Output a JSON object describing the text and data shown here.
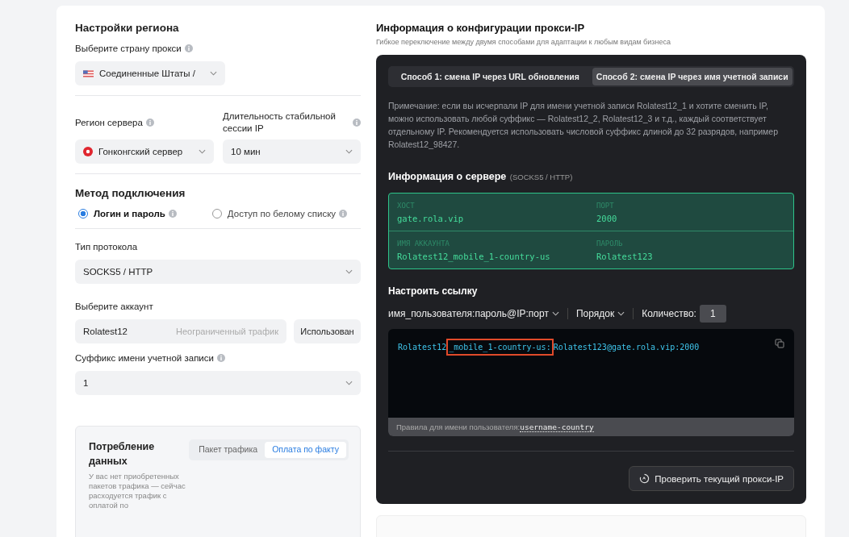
{
  "left": {
    "region_title": "Настройки региона",
    "country": {
      "label": "Выберите страну прокси",
      "value": "Соединенные Штаты /"
    },
    "server": {
      "label": "Регион сервера",
      "value": "Гонконгский сервер"
    },
    "session": {
      "label": "Длительность стабильной сессии IP",
      "value": "10 мин"
    },
    "method_title": "Метод подключения",
    "methods": [
      {
        "label": "Логин и пароль",
        "selected": true
      },
      {
        "label": "Доступ по белому списку",
        "selected": false
      }
    ],
    "protocol": {
      "label": "Тип протокола",
      "value": "SOCKS5 / HTTP"
    },
    "account": {
      "label": "Выберите аккаунт",
      "value": "Rolatest12",
      "traffic": "Неограниченный трафик",
      "used": "Использован"
    },
    "suffix": {
      "label": "Суффикс имени учетной записи",
      "value": "1"
    },
    "usage": {
      "title": "Потребление данных",
      "text": "У вас нет приобретенных пакетов трафика — сейчас расходуется трафик с оплатой по",
      "tabs": [
        {
          "label": "Пакет трафика",
          "selected": false
        },
        {
          "label": "Оплата по факту",
          "selected": true
        }
      ]
    }
  },
  "right": {
    "title": "Информация о конфигурации прокси-IP",
    "subtitle": "Гибкое переключение между двумя способами для адаптации к любым видам бизнеса",
    "tabs": [
      {
        "label": "Способ 1: смена IP через URL обновления",
        "selected": false
      },
      {
        "label": "Способ 2: смена IP через имя учетной записи",
        "selected": true
      }
    ],
    "note": "Примечание: если вы исчерпали IP для имени учетной записи Rolatest12_1 и хотите сменить IP, можно использовать любой суффикс — Rolatest12_2, Rolatest12_3 и т.д., каждый соответствует отдельному IP. Рекомендуется использовать числовой суффикс длиной до 32 разрядов, например Rolatest12_98427.",
    "server_title": "Информация о сервере",
    "server_sub": "(SOCKS5 / HTTP)",
    "server_info": [
      {
        "label": "ХОСТ",
        "value": "gate.rola.vip"
      },
      {
        "label": "ПОРТ",
        "value": "2000"
      },
      {
        "label": "ИМЯ АККАУНТА",
        "value": "Rolatest12_mobile_1-country-us"
      },
      {
        "label": "ПАРОЛЬ",
        "value": "Rolatest123"
      }
    ],
    "link_title": "Настроить ссылку",
    "format": "имя_пользователя:пароль@IP:порт",
    "order": "Порядок",
    "count_label": "Количество:",
    "count": "1",
    "code": [
      {
        "text": "Rolatest12",
        "highlighted": false
      },
      {
        "text": "_mobile_1-country-us:",
        "highlighted": true
      },
      {
        "text": "Rolatest123@gate.rola.vip:2000",
        "highlighted": false
      }
    ],
    "rules_label": "Правила для имени пользователя:",
    "rules_value": "username-country",
    "check_button": "Проверить текущий прокси-IP"
  }
}
